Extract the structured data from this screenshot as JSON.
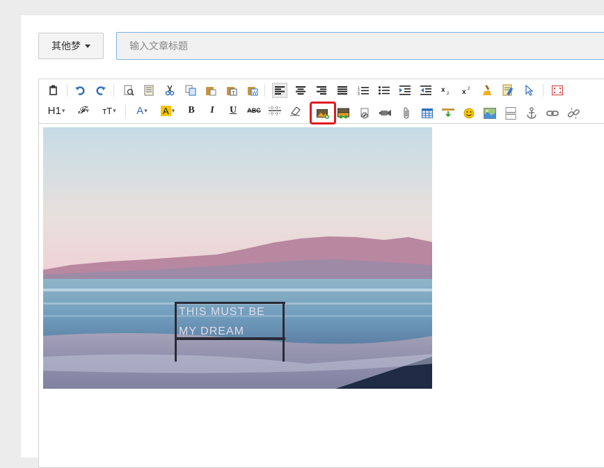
{
  "category_button": {
    "label": "其他梦",
    "icon": "caret-down-icon"
  },
  "title_input": {
    "placeholder": "输入文章标题",
    "value": ""
  },
  "toolbar": {
    "row1": [
      "clipboard-icon",
      "undo-icon",
      "redo-icon",
      "preview-icon",
      "template-icon",
      "cut-icon",
      "copy-icon",
      "paste-icon",
      "paste-text-icon",
      "paste-word-icon",
      "align-left-icon",
      "align-center-icon",
      "align-right-icon",
      "align-justify-icon",
      "ordered-list-icon",
      "unordered-list-icon",
      "indent-icon",
      "outdent-icon",
      "subscript-icon",
      "superscript-icon",
      "format-brush-icon",
      "format-clear-icon",
      "select-all-icon",
      "fullscreen-icon"
    ],
    "row2_labels": {
      "heading": "H1",
      "font": "𝓕",
      "size": "тT",
      "bold": "B",
      "italic": "I",
      "underline": "U",
      "strike": "ABC"
    },
    "row2": [
      "heading-icon",
      "font-family-icon",
      "font-size-icon",
      "font-color-icon",
      "highlight-color-icon",
      "bold-icon",
      "italic-icon",
      "underline-icon",
      "strikethrough-icon",
      "horizontal-rule-icon",
      "eraser-icon",
      "insert-image-icon",
      "multi-image-icon",
      "flash-icon",
      "video-icon",
      "attachment-icon",
      "table-icon",
      "insert-code-icon",
      "emoticon-icon",
      "map-icon",
      "page-break-icon",
      "anchor-icon",
      "link-icon",
      "unlink-icon"
    ]
  },
  "content": {
    "image_alt": "beach photo with sign",
    "sign_text_line1": "THIS MUST BE",
    "sign_text_line2": "MY DREAM"
  },
  "colors": {
    "highlight_border": "#e0191b",
    "input_border": "#7fb3e8",
    "accent_blue": "#2e6fbf"
  }
}
